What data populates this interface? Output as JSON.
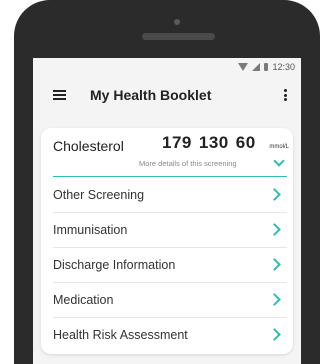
{
  "status_bar": {
    "time": "12:30",
    "icons": [
      "wifi-icon",
      "signal-icon",
      "battery-icon"
    ]
  },
  "app_bar": {
    "title": "My Health Booklet",
    "left_icon": "menu-icon",
    "right_icon": "more-vert-icon"
  },
  "cholesterol": {
    "label": "Cholesterol",
    "values": [
      "179",
      "130",
      "60"
    ],
    "unit": "mmol/L",
    "more_details": "More details of this screening",
    "toggle_icon": "chevron-down-icon"
  },
  "menu": {
    "items": [
      {
        "label": "Other Screening",
        "icon": "chevron-right-icon"
      },
      {
        "label": "Immunisation",
        "icon": "chevron-right-icon"
      },
      {
        "label": "Discharge Information",
        "icon": "chevron-right-icon"
      },
      {
        "label": "Medication",
        "icon": "chevron-right-icon"
      },
      {
        "label": "Health Risk Assessment",
        "icon": "chevron-right-icon"
      }
    ]
  },
  "colors": {
    "accent": "#2bbfb0",
    "phone_frame": "#2b2b2b",
    "app_background": "#f4f4f4"
  }
}
